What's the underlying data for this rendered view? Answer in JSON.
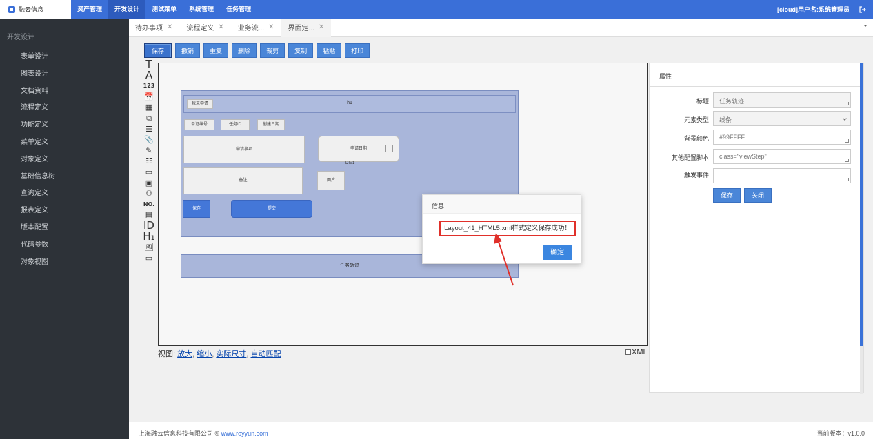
{
  "topbar": {
    "logo_text": "融云信息",
    "nav": [
      "资产管理",
      "开发设计",
      "测试菜单",
      "系统管理",
      "任务管理"
    ],
    "user": "[cloud]用户名:系统管理员"
  },
  "sidebar": {
    "group": "开发设计",
    "items": [
      "表单设计",
      "图表设计",
      "文档资料",
      "流程定义",
      "功能定义",
      "菜单定义",
      "对象定义",
      "基础信息树",
      "查询定义",
      "报表定义",
      "版本配置",
      "代码参数",
      "对象视图"
    ]
  },
  "tabs": [
    {
      "label": "待办事项"
    },
    {
      "label": "流程定义"
    },
    {
      "label": "业务流..."
    },
    {
      "label": "界面定..."
    }
  ],
  "toolbar": [
    "保存",
    "撤销",
    "重复",
    "删除",
    "裁剪",
    "复制",
    "粘贴",
    "打印"
  ],
  "palette": [
    "T",
    "A",
    "123",
    "📅",
    "▦",
    "⧉",
    "☰",
    "📎",
    "✎",
    "☷",
    "▭",
    "▣",
    "⚇",
    "NO.",
    "▤",
    "ID",
    "H₁",
    "🖼",
    "▭"
  ],
  "form": {
    "h1_label": "h1",
    "apply_tag": "我来申请",
    "f_voucher": "单证编号",
    "f_taskid": "任务ID",
    "f_created": "创建日期",
    "f_item": "申请事项",
    "f_date": "申请日期",
    "f_div": "DIV1",
    "f_note": "备注",
    "f_image": "图片",
    "b_save": "保存",
    "b_submit": "提交",
    "track": "任务轨迹"
  },
  "view": {
    "prefix": "视图:",
    "zoom_in": "放大",
    "zoom_out": "缩小",
    "actual": "实际尺寸",
    "auto": "自动匹配",
    "xml": "XML"
  },
  "props": {
    "title": "属性",
    "rows": [
      {
        "label": "标题",
        "value": "任务轨迹"
      },
      {
        "label": "元素类型",
        "value": "线条"
      },
      {
        "label": "背景颜色",
        "value": "#99FFFF"
      },
      {
        "label": "其他配置脚本",
        "value": "class=\"viewStep\""
      },
      {
        "label": "触发事件",
        "value": ""
      }
    ],
    "save": "保存",
    "close": "关闭"
  },
  "dialog": {
    "title": "信息",
    "message": "Layout_41_HTML5.xml样式定义保存成功！",
    "ok": "确定"
  },
  "footer": {
    "copyright": "上海融云信息科技有限公司 ©",
    "link": "www.royyun.com",
    "version": "当前版本：v1.0.0"
  },
  "colors": {
    "topbar": "#3a6fd8",
    "sidebar": "#2d3238",
    "accent": "#4a86d8",
    "highlight": "#e0302a"
  }
}
